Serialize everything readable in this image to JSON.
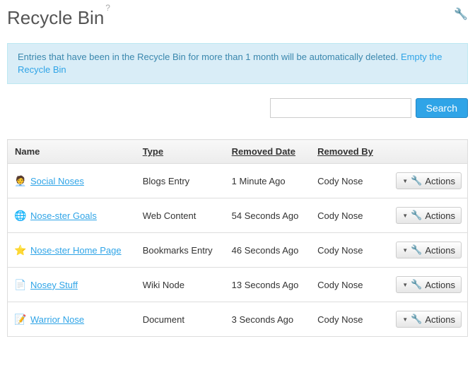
{
  "header": {
    "title": "Recycle Bin",
    "help_mark": "?"
  },
  "alert": {
    "text_before_link": "Entries that have been in the Recycle Bin for more than 1 month will be automatically deleted. ",
    "link": "Empty the Recycle Bin"
  },
  "search": {
    "placeholder": "",
    "button": "Search"
  },
  "table": {
    "columns": {
      "name": "Name",
      "type": "Type",
      "removed_date": "Removed Date",
      "removed_by": "Removed By"
    },
    "actions_label": "Actions",
    "rows": [
      {
        "icon": "blogs-entry-icon",
        "glyph": "🧑‍💼",
        "name": "Social Noses",
        "type": "Blogs Entry",
        "removed_date": "1 Minute Ago",
        "removed_by": "Cody Nose"
      },
      {
        "icon": "web-content-icon",
        "glyph": "🌐",
        "name": "Nose-ster Goals",
        "type": "Web Content",
        "removed_date": "54 Seconds Ago",
        "removed_by": "Cody Nose"
      },
      {
        "icon": "bookmarks-entry-icon",
        "glyph": "⭐",
        "name": "Nose-ster Home Page",
        "type": "Bookmarks Entry",
        "removed_date": "46 Seconds Ago",
        "removed_by": "Cody Nose"
      },
      {
        "icon": "wiki-node-icon",
        "glyph": "📄",
        "name": "Nosey Stuff",
        "type": "Wiki Node",
        "removed_date": "13 Seconds Ago",
        "removed_by": "Cody Nose"
      },
      {
        "icon": "document-icon",
        "glyph": "📝",
        "name": "Warrior Nose",
        "type": "Document",
        "removed_date": "3 Seconds Ago",
        "removed_by": "Cody Nose"
      }
    ]
  }
}
